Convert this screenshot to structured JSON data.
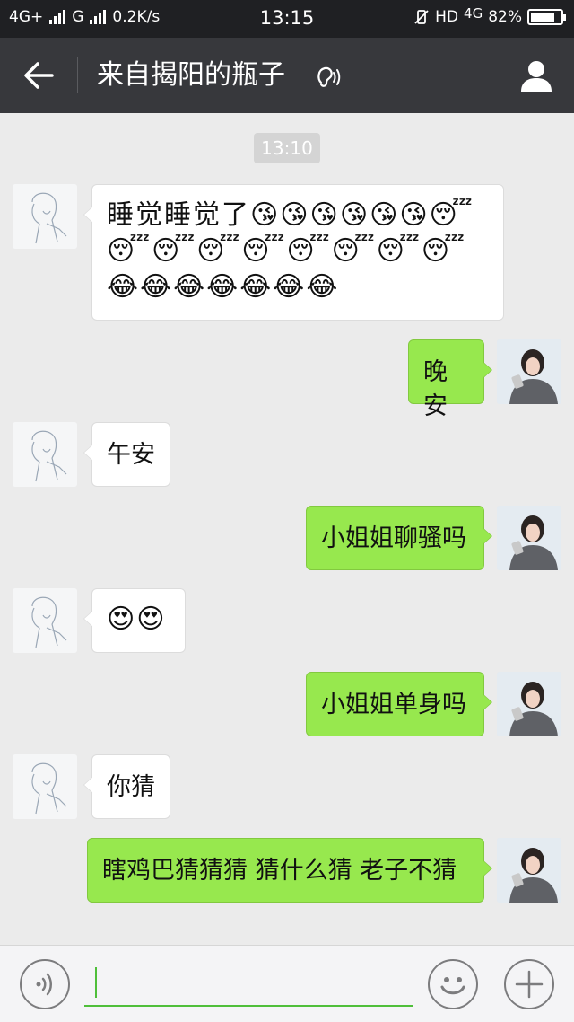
{
  "status_bar": {
    "network1": "4G+",
    "network2": "G",
    "speed": "0.2K/s",
    "time": "13:15",
    "hd": "HD",
    "network3": "4G",
    "battery": "82%",
    "battery_level": 0.82
  },
  "header": {
    "title": "来自揭阳的瓶子",
    "back_icon": "arrow-left-icon",
    "earpiece_icon": "ear-icon",
    "profile_icon": "person-icon"
  },
  "chat": {
    "timestamp": "13:10",
    "messages": [
      {
        "side": "in",
        "text": "睡觉睡觉了😘😘😘😘😘😘😴😴😴😴😴😴😴😴😴😂😂😂😂😂😂😂"
      },
      {
        "side": "out",
        "text": "晚安"
      },
      {
        "side": "in",
        "text": "午安"
      },
      {
        "side": "out",
        "text": "小姐姐聊骚吗"
      },
      {
        "side": "in",
        "text": "😍😍"
      },
      {
        "side": "out",
        "text": "小姐姐单身吗"
      },
      {
        "side": "in",
        "text": "你猜"
      },
      {
        "side": "out",
        "text": "瞎鸡巴猜猜猜 猜什么猜 老子不猜"
      }
    ]
  },
  "input_bar": {
    "voice_icon": "voice-icon",
    "input_value": "",
    "emoji_icon": "smiley-icon",
    "plus_icon": "plus-icon"
  },
  "colors": {
    "outgoing_bubble": "#97e84e",
    "incoming_bubble": "#ffffff",
    "header_bg": "#37383c",
    "chat_bg": "#ebebeb"
  }
}
